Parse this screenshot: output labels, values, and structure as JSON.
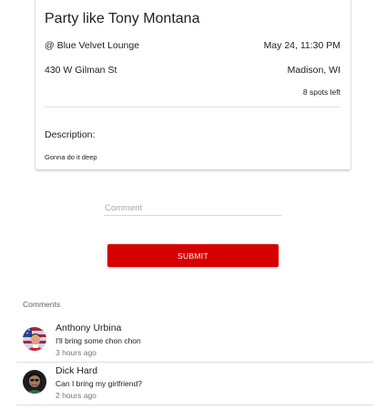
{
  "event": {
    "title": "Party like Tony Montana",
    "venue": "@ Blue Velvet Lounge",
    "datetime": "May 24, 11:30 PM",
    "address": "430 W Gilman St",
    "city": "Madison, WI",
    "spots": "8 spots left",
    "description_label": "Description:",
    "description": "Gonna do it deep"
  },
  "comment_form": {
    "placeholder": "Comment",
    "value": "",
    "submit_label": "SUBMIT"
  },
  "comments": {
    "heading": "Comments",
    "items": [
      {
        "author": "Anthony Urbina",
        "text": "I'll bring some chon chon",
        "time": "3 hours ago",
        "avatar_icon": "flag-portrait-avatar"
      },
      {
        "author": "Dick Hard",
        "text": "Can I bring my girlfriend?",
        "time": "2 hours ago",
        "avatar_icon": "person-photo-avatar"
      }
    ]
  },
  "colors": {
    "accent": "#d50000",
    "divider": "#e0e0e0",
    "secondary_text": "#757575"
  }
}
